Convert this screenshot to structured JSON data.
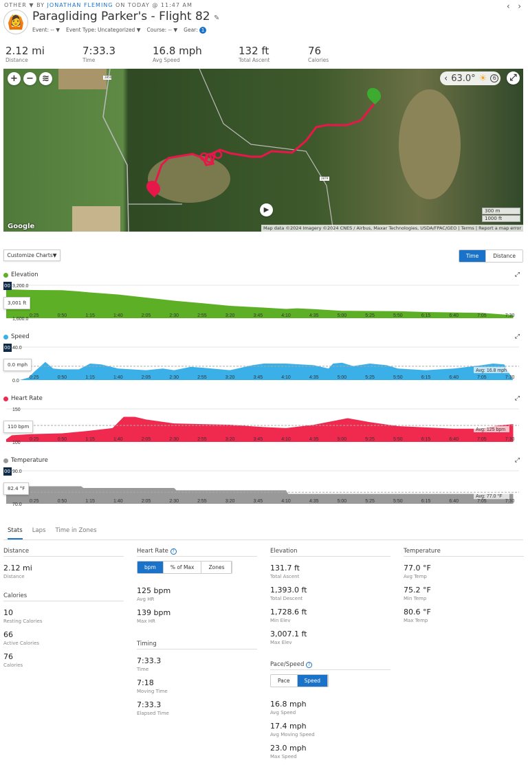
{
  "header": {
    "category": "OTHER",
    "by": "BY",
    "author": "JONATHAN FLEMING",
    "on": "ON TODAY @",
    "time": "11:47 AM",
    "title": "Paragliding Parker's - Flight 82",
    "meta": [
      {
        "label": "Event: --"
      },
      {
        "label": "Event Type: Uncategorized"
      },
      {
        "label": "Course: --"
      },
      {
        "label": "Gear:",
        "badge": "1"
      }
    ]
  },
  "summary": [
    {
      "value": "2.12 mi",
      "label": "Distance"
    },
    {
      "value": "7:33.3",
      "label": "Time"
    },
    {
      "value": "16.8 mph",
      "label": "Avg Speed"
    },
    {
      "value": "132 ft",
      "label": "Total Ascent"
    },
    {
      "value": "76",
      "label": "Calories"
    }
  ],
  "map": {
    "temperature": "63.0°",
    "weather_icon": "sun-icon",
    "wind": "6",
    "scale_m": "300 m",
    "scale_ft": "1000 ft",
    "attribution": "Map data ©2024 Imagery ©2024 CNES / Airbus, Maxar Technologies, USDA/FPAC/GEO",
    "terms": "Terms",
    "report": "Report a map error",
    "logo": "Google",
    "road1": "2850",
    "road2": "2879",
    "route_color": "#e8174a"
  },
  "charts_toolbar": {
    "customize": "Customize Charts",
    "time": "Time",
    "distance": "Distance",
    "selected": "Time"
  },
  "chart_data": [
    {
      "type": "area",
      "title": "Elevation",
      "color": "#5db025",
      "ylim": [
        1600,
        3200
      ],
      "ytick_top": "3,200.0",
      "ytick_bottom": "1,600.0",
      "tooltip": "3,001 ft",
      "tooltip_tag": "00",
      "x": [
        "0:00",
        "0:25",
        "0:50",
        "1:05",
        "1:15",
        "1:40",
        "2:05",
        "2:30",
        "2:55",
        "3:20",
        "3:45",
        "4:10",
        "4:20",
        "4:35",
        "5:00",
        "5:25",
        "5:50",
        "6:15",
        "6:40",
        "7:05",
        "7:30",
        "7:33"
      ],
      "values": [
        3001,
        2967,
        2960,
        2900,
        2850,
        2750,
        2600,
        2450,
        2330,
        2200,
        2130,
        2050,
        2080,
        2040,
        1960,
        1950,
        1940,
        1900,
        1880,
        1860,
        1760,
        1740
      ]
    },
    {
      "type": "area",
      "title": "Speed",
      "color": "#3bb0e8",
      "ylim": [
        0,
        40
      ],
      "ytick_top": "40.0",
      "ytick_bottom": "0.0",
      "tooltip": "0.0 mph",
      "tooltip_tag": "00",
      "avg": 16.8,
      "avg_label": "Avg: 16.8 mph",
      "x": [
        "0:00",
        "0:12",
        "0:20",
        "0:25",
        "0:35",
        "0:42",
        "0:50",
        "1:05",
        "1:15",
        "1:25",
        "1:40",
        "2:05",
        "2:20",
        "2:30",
        "2:45",
        "2:55",
        "3:20",
        "3:40",
        "3:50",
        "4:10",
        "4:35",
        "4:48",
        "4:52",
        "5:00",
        "5:10",
        "5:25",
        "5:40",
        "5:50",
        "6:15",
        "6:40",
        "7:05",
        "7:15",
        "7:25",
        "7:33"
      ],
      "values": [
        0,
        0,
        3,
        10,
        22,
        14,
        13,
        13,
        20,
        19,
        14,
        12,
        14,
        12,
        16,
        15,
        12,
        18,
        20,
        20,
        18,
        14,
        20,
        21,
        17,
        20,
        18,
        14,
        12,
        14,
        18,
        20,
        19,
        0
      ]
    },
    {
      "type": "area",
      "title": "Heart Rate",
      "color": "#f0294e",
      "ylim": [
        100,
        150
      ],
      "ytick_top": "150",
      "ytick_bottom": "100",
      "tooltip": "110 bpm",
      "avg": 125,
      "avg_label": "Avg: 125 bpm",
      "x": [
        "0:00",
        "0:05",
        "0:25",
        "0:50",
        "1:15",
        "1:35",
        "1:45",
        "1:55",
        "2:05",
        "2:30",
        "2:55",
        "3:20",
        "3:45",
        "4:10",
        "4:35",
        "5:05",
        "5:25",
        "5:50",
        "6:15",
        "6:40",
        "7:05",
        "7:20",
        "7:33"
      ],
      "values": [
        104,
        110,
        112,
        113,
        117,
        121,
        138,
        138,
        134,
        128,
        127,
        126,
        123,
        121,
        126,
        136,
        130,
        124,
        122,
        120,
        120,
        125,
        127
      ]
    },
    {
      "type": "area",
      "title": "Temperature",
      "color": "#999999",
      "ylim": [
        70,
        90
      ],
      "ytick_top": "90.0",
      "ytick_bottom": "70.0",
      "tooltip": "82.4 °F",
      "tooltip_tag": "00",
      "avg": 77.0,
      "avg_label": "Avg: 77.0 °F",
      "x": [
        "0:00",
        "1:07",
        "1:09",
        "2:30",
        "2:32",
        "4:10",
        "4:12",
        "7:33"
      ],
      "values": [
        80.6,
        80.6,
        79.6,
        79.6,
        78.2,
        78.2,
        76.0,
        76.0
      ]
    }
  ],
  "xticks": [
    "0:25",
    "0:50",
    "1:15",
    "1:40",
    "2:05",
    "2:30",
    "2:55",
    "3:20",
    "3:45",
    "4:10",
    "4:35",
    "5:00",
    "5:25",
    "5:50",
    "6:15",
    "6:40",
    "7:05",
    "7:30"
  ],
  "tabs": [
    {
      "label": "Stats",
      "active": true
    },
    {
      "label": "Laps"
    },
    {
      "label": "Time in Zones"
    }
  ],
  "stats": {
    "distance": {
      "title": "Distance",
      "items": [
        {
          "value": "2.12 mi",
          "label": "Distance"
        }
      ]
    },
    "calories": {
      "title": "Calories",
      "items": [
        {
          "value": "10",
          "label": "Resting Calories"
        },
        {
          "value": "66",
          "label": "Active Calories"
        },
        {
          "value": "76",
          "label": "Calories"
        }
      ]
    },
    "heart_rate": {
      "title": "Heart Rate",
      "toggle": [
        "bpm",
        "% of Max",
        "Zones"
      ],
      "items": [
        {
          "value": "125 bpm",
          "label": "Avg HR"
        },
        {
          "value": "139 bpm",
          "label": "Max HR"
        }
      ]
    },
    "timing": {
      "title": "Timing",
      "items": [
        {
          "value": "7:33.3",
          "label": "Time"
        },
        {
          "value": "7:18",
          "label": "Moving Time"
        },
        {
          "value": "7:33.3",
          "label": "Elapsed Time"
        }
      ]
    },
    "elevation": {
      "title": "Elevation",
      "items": [
        {
          "value": "131.7 ft",
          "label": "Total Ascent"
        },
        {
          "value": "1,393.0 ft",
          "label": "Total Descent"
        },
        {
          "value": "1,728.6 ft",
          "label": "Min Elev"
        },
        {
          "value": "3,007.1 ft",
          "label": "Max Elev"
        }
      ]
    },
    "pace_speed": {
      "title": "Pace/Speed",
      "toggle": [
        "Pace",
        "Speed"
      ],
      "items": [
        {
          "value": "16.8 mph",
          "label": "Avg Speed"
        },
        {
          "value": "17.4 mph",
          "label": "Avg Moving Speed"
        },
        {
          "value": "23.0 mph",
          "label": "Max Speed"
        }
      ]
    },
    "temperature": {
      "title": "Temperature",
      "items": [
        {
          "value": "77.0 °F",
          "label": "Avg Temp"
        },
        {
          "value": "75.2 °F",
          "label": "Min Temp"
        },
        {
          "value": "80.6 °F",
          "label": "Max Temp"
        }
      ]
    }
  }
}
